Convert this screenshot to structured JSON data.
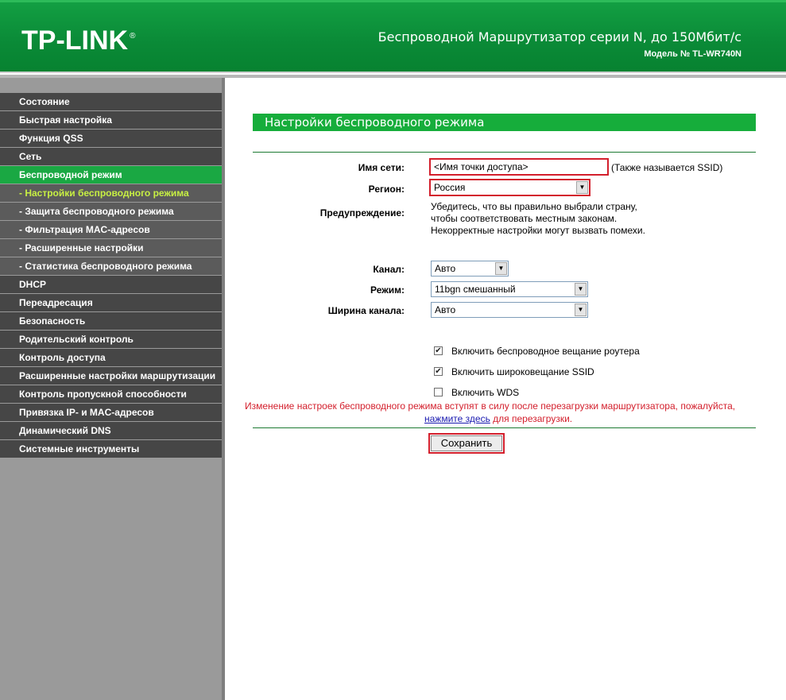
{
  "header": {
    "logo": "TP-LINK",
    "logo_mark": "®",
    "product_title": "Беспроводной Маршрутизатор серии N, до 150Мбит/с",
    "model": "Модель № TL-WR740N"
  },
  "sidebar": {
    "items": [
      {
        "label": "Состояние",
        "sub": false,
        "active": false
      },
      {
        "label": "Быстрая настройка",
        "sub": false,
        "active": false
      },
      {
        "label": "Функция QSS",
        "sub": false,
        "active": false
      },
      {
        "label": "Сеть",
        "sub": false,
        "active": false
      },
      {
        "label": "Беспроводной режим",
        "sub": false,
        "active": true
      },
      {
        "label": "- Настройки беспроводного режима",
        "sub": true,
        "active": true
      },
      {
        "label": "- Защита беспроводного режима",
        "sub": true,
        "active": false
      },
      {
        "label": "- Фильтрация MAC-адресов",
        "sub": true,
        "active": false
      },
      {
        "label": "- Расширенные настройки",
        "sub": true,
        "active": false
      },
      {
        "label": "- Статистика беспроводного режима",
        "sub": true,
        "active": false
      },
      {
        "label": "DHCP",
        "sub": false,
        "active": false
      },
      {
        "label": "Переадресация",
        "sub": false,
        "active": false
      },
      {
        "label": "Безопасность",
        "sub": false,
        "active": false
      },
      {
        "label": "Родительский контроль",
        "sub": false,
        "active": false
      },
      {
        "label": "Контроль доступа",
        "sub": false,
        "active": false
      },
      {
        "label": "Расширенные настройки маршрутизации",
        "sub": false,
        "active": false
      },
      {
        "label": "Контроль пропускной способности",
        "sub": false,
        "active": false
      },
      {
        "label": "Привязка IP- и MAC-адресов",
        "sub": false,
        "active": false
      },
      {
        "label": "Динамический DNS",
        "sub": false,
        "active": false
      },
      {
        "label": "Системные инструменты",
        "sub": false,
        "active": false
      }
    ]
  },
  "main": {
    "section_title": "Настройки беспроводного режима",
    "ssid": {
      "label": "Имя сети:",
      "value": "<Имя точки доступа>",
      "hint": "(Также называется SSID)"
    },
    "region": {
      "label": "Регион:",
      "value": "Россия"
    },
    "warning": {
      "label": "Предупреждение:",
      "lines": [
        "Убедитесь, что вы правильно выбрали страну,",
        "чтобы соответствовать местным законам.",
        "Некорректные настройки могут вызвать помехи."
      ]
    },
    "channel": {
      "label": "Канал:",
      "value": "Авто"
    },
    "mode": {
      "label": "Режим:",
      "value": "11bgn смешанный"
    },
    "width": {
      "label": "Ширина канала:",
      "value": "Авто"
    },
    "checkboxes": [
      {
        "label": "Включить беспроводное вещание роутера",
        "checked": true
      },
      {
        "label": "Включить широковещание SSID",
        "checked": true
      },
      {
        "label": "Включить WDS",
        "checked": false
      }
    ],
    "notice_line1": "Изменение настроек беспроводного режима вступят в силу после перезагрузки маршрутизатора, пожалуйста,",
    "notice_link": "нажмите здесь",
    "notice_line2": " для перезагрузки.",
    "save_label": "Сохранить"
  },
  "colors": {
    "header_green": "#0a8a37",
    "menu_dark": "#464646",
    "menu_sub": "#5b5b5b",
    "menu_active": "#1aa843",
    "submenu_active_text": "#c7ef43",
    "highlight_red": "#d31f2c",
    "notice_red": "#d31f2c"
  }
}
